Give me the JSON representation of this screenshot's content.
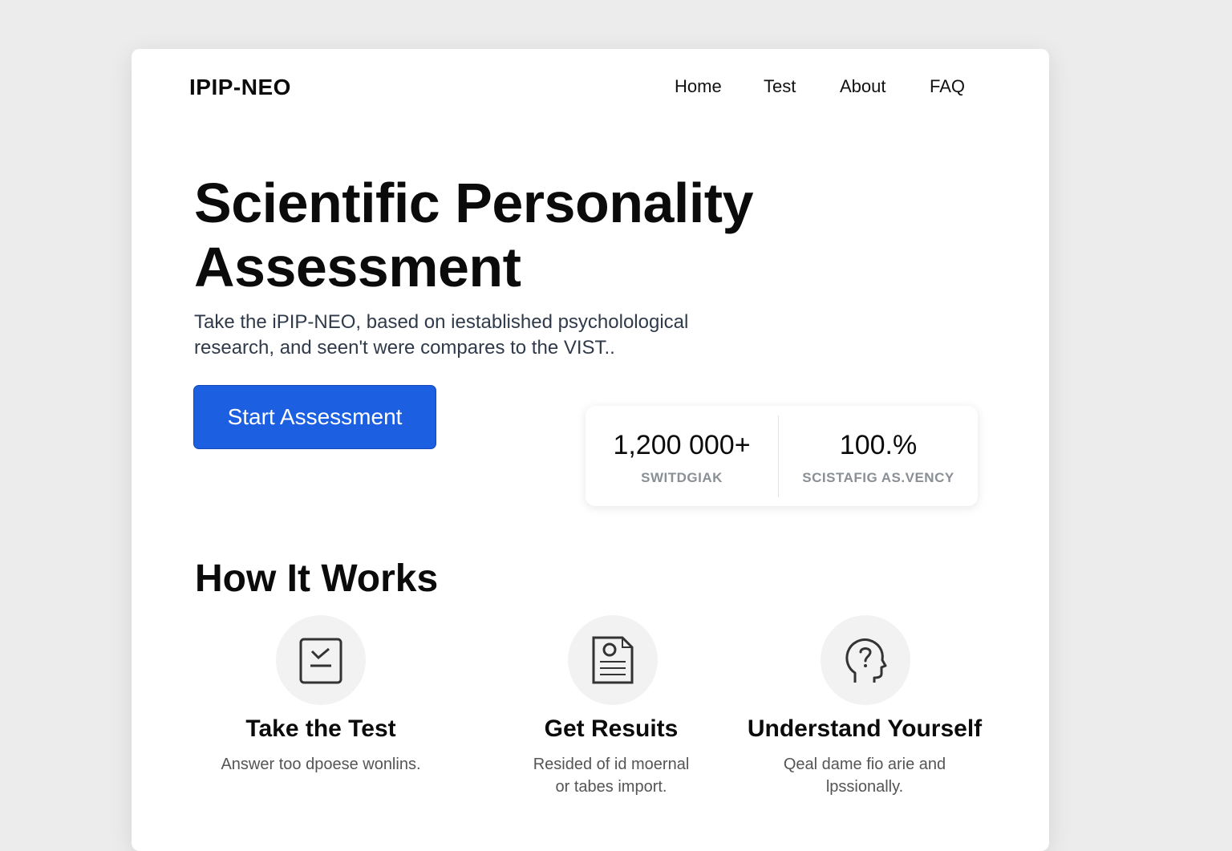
{
  "brand": "IPIP-NEO",
  "nav": [
    {
      "label": "Home"
    },
    {
      "label": "Test"
    },
    {
      "label": "About"
    },
    {
      "label": "FAQ"
    }
  ],
  "hero": {
    "title_line1": "Scientific Personality",
    "title_line2": "Assessment",
    "subtitle_line1": "Take the iPIP-NEO, based on iestablished psycholological",
    "subtitle_line2": "research, and seen't were compares to the VIST..",
    "cta_label": "Start Assessment"
  },
  "stats": [
    {
      "value": "1,200 000+",
      "label": "SWITDGIAK"
    },
    {
      "value": "100.%",
      "label": "SCISTAFIG AS.VENCY"
    }
  ],
  "how_it_works": {
    "title": "How It Works",
    "steps": [
      {
        "icon": "checklist-icon",
        "title": "Take the Test",
        "desc_line1": "Answer too dpoese wonlins.",
        "desc_line2": ""
      },
      {
        "icon": "document-icon",
        "title": "Get Resuits",
        "desc_line1": "Resided of id moernal",
        "desc_line2": "or tabes import."
      },
      {
        "icon": "head-profile-icon",
        "title": "Understand Yourself",
        "desc_line1": "Qeal dame fio arie and",
        "desc_line2": "lpssionally."
      }
    ]
  },
  "colors": {
    "accent": "#1c5fe0",
    "background": "#ececec",
    "card": "#ffffff",
    "muted_text": "#8a8f96"
  }
}
